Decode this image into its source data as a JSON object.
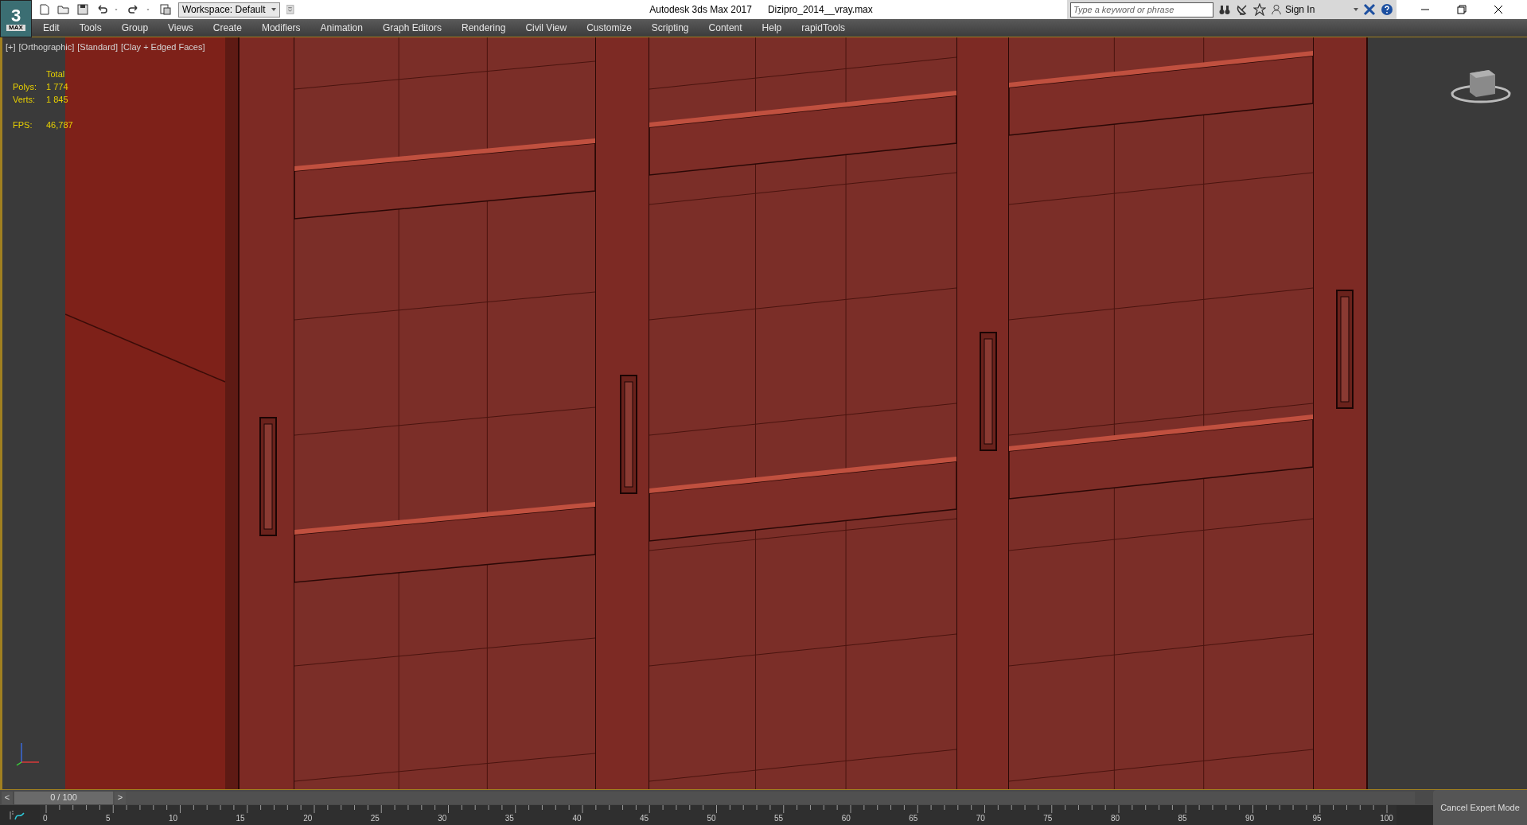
{
  "title_bar": {
    "logo": {
      "digit": "3",
      "label": "MAX"
    },
    "workspace": "Workspace: Default",
    "title": "Autodesk 3ds Max 2017",
    "file": "Dizipro_2014__vray.max",
    "search": {
      "placeholder": "Type a keyword or phrase"
    },
    "sign_in": "Sign In"
  },
  "menu": [
    "Edit",
    "Tools",
    "Group",
    "Views",
    "Create",
    "Modifiers",
    "Animation",
    "Graph Editors",
    "Rendering",
    "Civil View",
    "Customize",
    "Scripting",
    "Content",
    "Help",
    "rapidTools"
  ],
  "viewport": {
    "labels": [
      "[+]",
      "[Orthographic]",
      "[Standard]",
      "[Clay + Edged Faces]"
    ],
    "stats": {
      "header": "Total",
      "rows": [
        {
          "label": "Polys:",
          "value": "1 774"
        },
        {
          "label": "Verts:",
          "value": "1 845"
        }
      ],
      "fps": {
        "label": "FPS:",
        "value": "46,787"
      }
    }
  },
  "timeline": {
    "prev": "<",
    "frame": "0 / 100",
    "level": 0,
    "next": ">",
    "ticks": [
      "0",
      "5",
      "10",
      "15",
      "20",
      "25",
      "30",
      "35",
      "40",
      "45",
      "50",
      "55",
      "60",
      "65",
      "70",
      "75",
      "80",
      "85",
      "90",
      "95",
      "100"
    ]
  },
  "cancel_button": "Cancel Expert Mode"
}
